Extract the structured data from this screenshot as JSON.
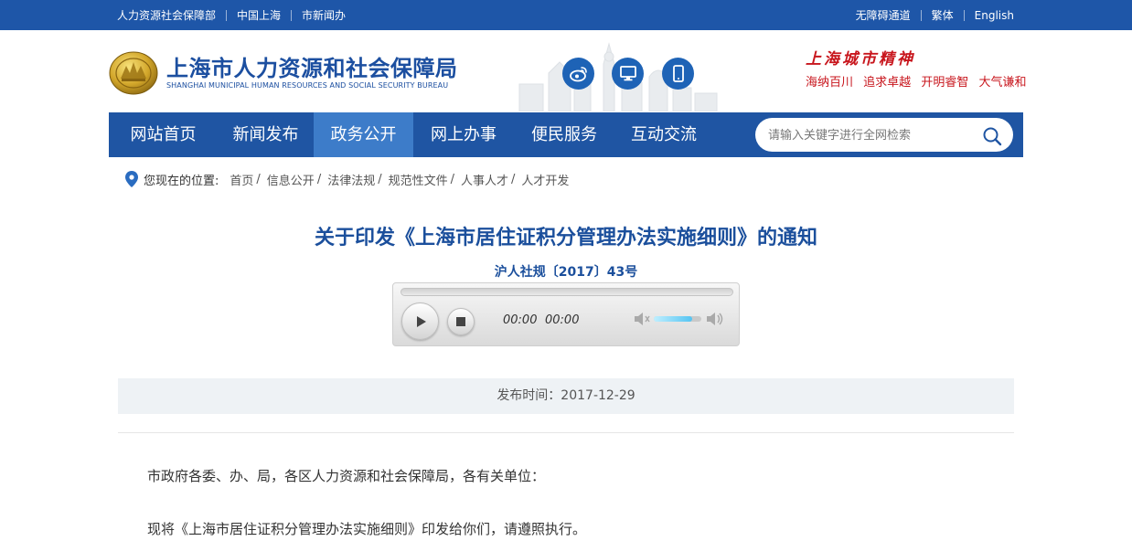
{
  "topbar": {
    "left_links": [
      "人力资源社会保障部",
      "中国上海",
      "市新闻办"
    ],
    "right_links": [
      "无障碍通道",
      "繁体",
      "English"
    ],
    "bg_color": "#1e56a8"
  },
  "header": {
    "site_name_cn": "上海市人力资源和社会保障局",
    "site_name_en": "SHANGHAI MUNICIPAL HUMAN RESOURCES AND SOCIAL SECURITY BUREAU",
    "channels": [
      "weibo-icon",
      "desktop-icon",
      "mobile-icon"
    ],
    "city_spirit": {
      "title": "上海城市精神",
      "items": [
        "海纳百川",
        "追求卓越",
        "开明睿智",
        "大气谦和"
      ],
      "color": "#c8161d"
    }
  },
  "nav": {
    "items": [
      "网站首页",
      "新闻发布",
      "政务公开",
      "网上办事",
      "便民服务",
      "互动交流"
    ],
    "active": "政务公开",
    "search_placeholder": "请输入关键字进行全网检索",
    "bg_color": "#1f55a3",
    "active_color": "#3d7cc9"
  },
  "breadcrumb": {
    "prefix": "您现在的位置:",
    "items": [
      "首页",
      "信息公开",
      "法律法规",
      "规范性文件",
      "人事人才",
      "人才开发"
    ]
  },
  "article": {
    "title": "关于印发《上海市居住证积分管理办法实施细则》的通知",
    "doc_number": "沪人社规〔2017〕43号",
    "publish_label": "发布时间：2017-12-29",
    "paragraphs": [
      "市政府各委、办、局，各区人力资源和社会保障局，各有关单位：",
      "现将《上海市居住证积分管理办法实施细则》印发给你们，请遵照执行。"
    ],
    "title_color": "#1b4f9c"
  },
  "audio_player": {
    "current_time": "00:00",
    "duration": "00:00",
    "progress_fraction": 0,
    "volume_fraction": 0.8
  }
}
